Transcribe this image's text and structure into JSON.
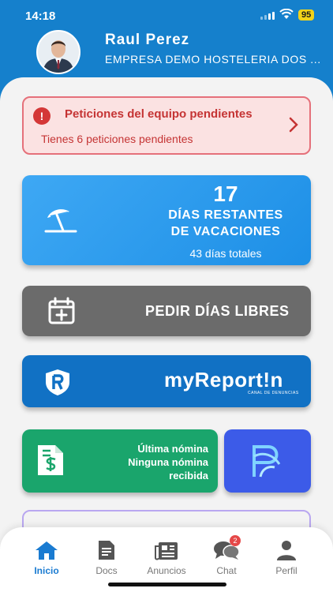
{
  "status": {
    "time": "14:18",
    "battery": "95"
  },
  "user": {
    "name": "Raul Perez",
    "company": "EMPRESA DEMO HOSTELERIA DOS ..."
  },
  "alert": {
    "title": "Peticiones del equipo pendientes",
    "subtitle": "Tienes 6 peticiones pendientes"
  },
  "vacation": {
    "remaining": "17",
    "line1": "DÍAS RESTANTES",
    "line2": "DE VACACIONES",
    "total": "43 días totales"
  },
  "request_days": {
    "label": "PEDIR DÍAS LIBRES"
  },
  "report": {
    "brand": "myReport!n",
    "tagline": "CANAL DE DENUNCIAS"
  },
  "payroll": {
    "line1": "Última nómina",
    "line2": "Ninguna nómina",
    "line3": "recibida"
  },
  "tabs": [
    {
      "label": "Inicio",
      "icon": "home-icon",
      "active": true
    },
    {
      "label": "Docs",
      "icon": "document-icon"
    },
    {
      "label": "Anuncios",
      "icon": "newspaper-icon"
    },
    {
      "label": "Chat",
      "icon": "chat-icon",
      "badge": "2"
    },
    {
      "label": "Perfil",
      "icon": "user-icon"
    }
  ],
  "colors": {
    "header_blue": "#1580cc",
    "alert_red": "#c53434",
    "vacation_blue": "#2a9bf0",
    "libres_gray": "#6b6b6b",
    "report_blue": "#1171c4",
    "payroll_green": "#1aa56c",
    "logo_indigo": "#3c5be8",
    "tab_active": "#1a7bd1"
  }
}
